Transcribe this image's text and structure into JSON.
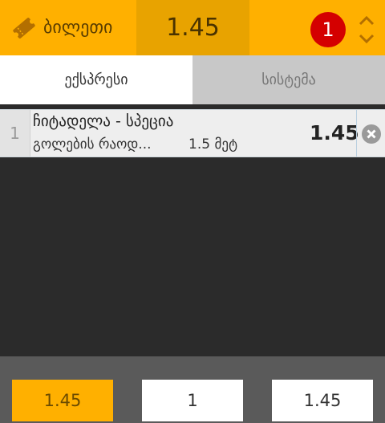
{
  "header": {
    "ticket_label": "ბილეთი",
    "total_odds": "1.45",
    "bet_count": "1",
    "colors": {
      "accent": "#ffb000",
      "accent_dark": "#e8a300",
      "badge": "#d40000"
    },
    "icons": {
      "ticket": "ticket-icon",
      "sort": "sort-icon"
    }
  },
  "tabs": [
    {
      "label": "ექსპრესი",
      "active": true
    },
    {
      "label": "სისტემა",
      "active": false
    }
  ],
  "bets": [
    {
      "index": "1",
      "event": "ჩიტადელა - სპეცია",
      "market": "გოლების რაოდ...",
      "selection": "1.5 მეტ",
      "odds": "1.45",
      "remove_icon": "close-circle-icon"
    }
  ],
  "footer": {
    "odds_button": "1.45",
    "stake_input": "1",
    "payout_button": "1.45"
  }
}
